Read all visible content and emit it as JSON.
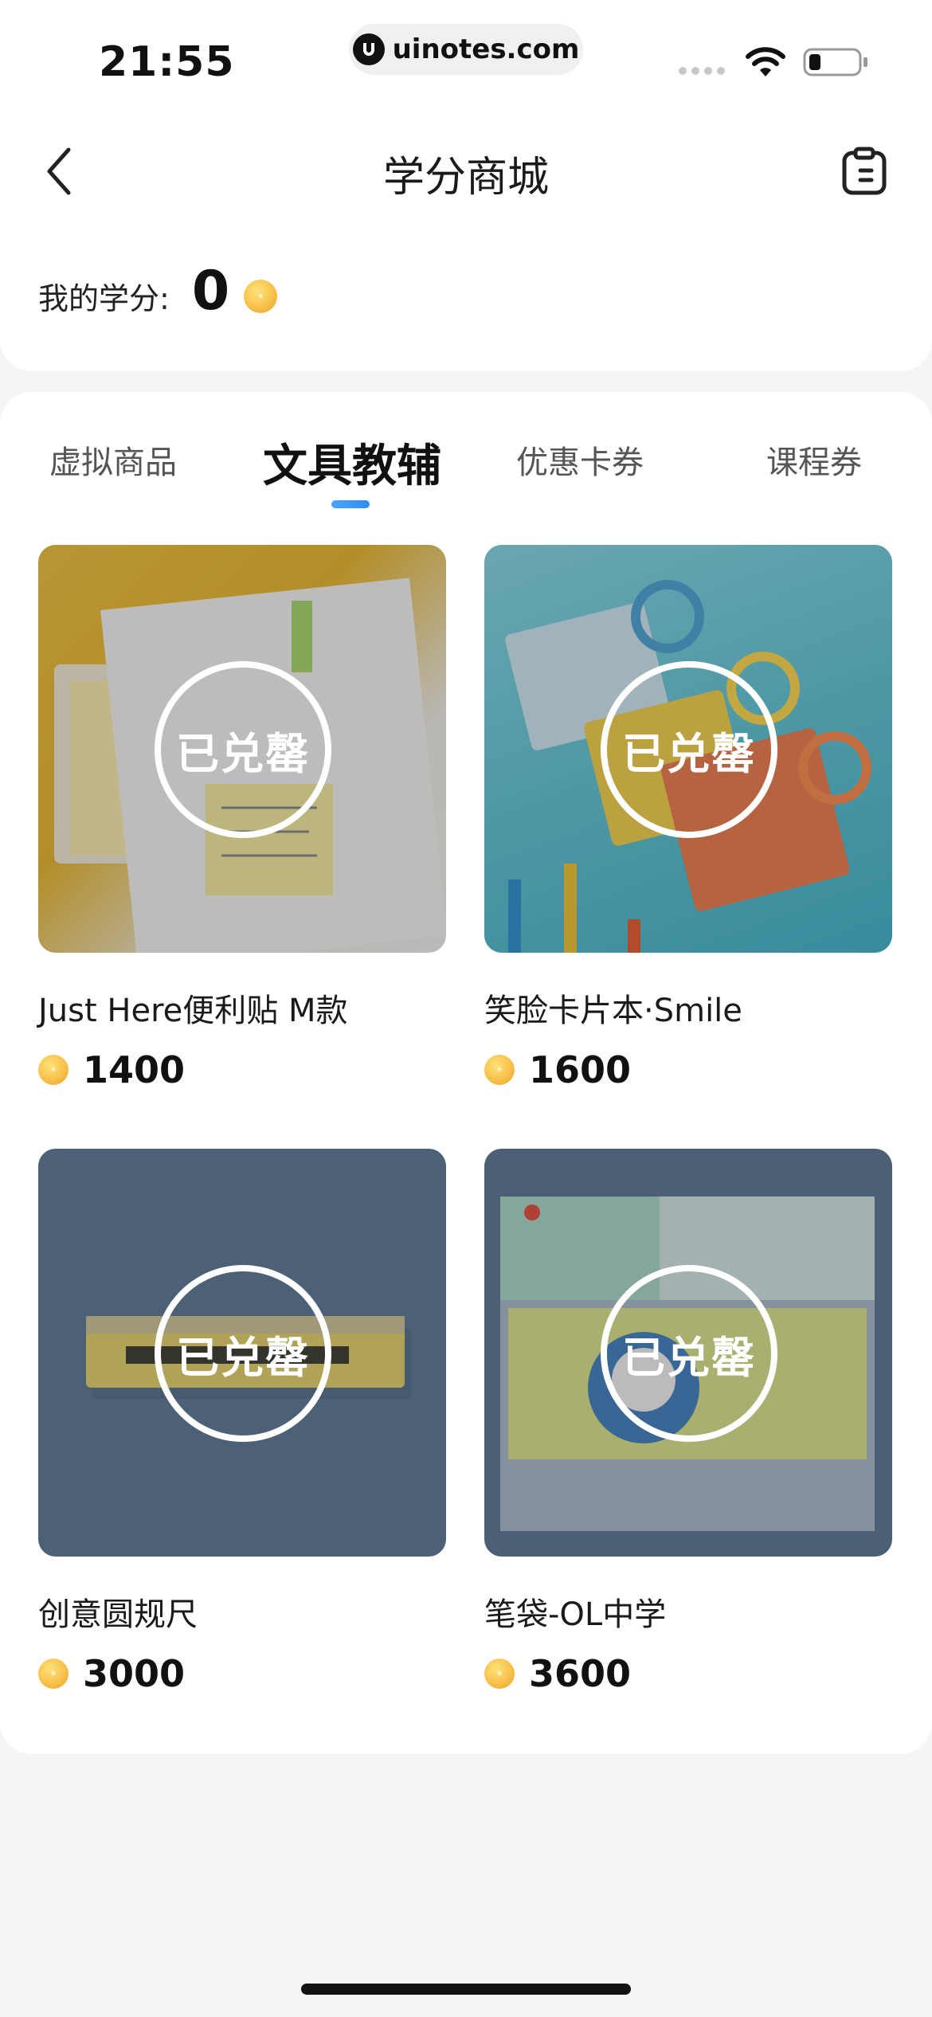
{
  "status_bar": {
    "time": "21:55",
    "url": "uinotes.com"
  },
  "nav": {
    "title": "学分商城"
  },
  "credits": {
    "label": "我的学分:",
    "value": "0"
  },
  "tabs": [
    {
      "label": "虚拟商品",
      "active": false
    },
    {
      "label": "文具教辅",
      "active": true
    },
    {
      "label": "优惠卡券",
      "active": false
    },
    {
      "label": "课程券",
      "active": false
    }
  ],
  "products": [
    {
      "name": "Just Here便利贴 M款",
      "price": "1400",
      "status": "已兑罄"
    },
    {
      "name": "笑脸卡片本·Smile",
      "price": "1600",
      "status": "已兑罄"
    },
    {
      "name": "创意圆规尺",
      "price": "3000",
      "status": "已兑罄"
    },
    {
      "name": "笔袋-OL中学",
      "price": "3600",
      "status": "已兑罄"
    }
  ],
  "colors": {
    "accent": "#2f8cf0",
    "coin": "#f7c14b",
    "background": "#f4f5f7"
  }
}
